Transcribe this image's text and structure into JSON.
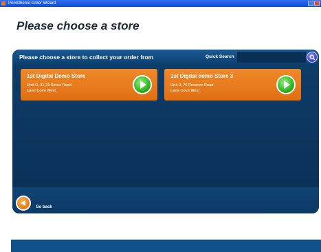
{
  "window": {
    "title": "Printstheme Order Wizard"
  },
  "page": {
    "title": "Please choose a store"
  },
  "panel": {
    "heading": "Please choose a store to collect your order from",
    "quick_search_label": "Quick Search",
    "search_value": "",
    "search_placeholder": ""
  },
  "stores": [
    {
      "name": "1st Digital Demo Store",
      "address_line1": "Unit C, 31-33 Sirius Road",
      "address_line2": "Lane Cove West"
    },
    {
      "name": "1st Digital demo Store 3",
      "address_line1": "Unit 3, 76 Reserve Road",
      "address_line2": "Lane Cove West"
    }
  ],
  "footer": {
    "back_label": "Go back"
  },
  "colors": {
    "panel": "#0b3a66",
    "card": "#e57a1a",
    "go_button": "#22a81a",
    "back_button": "#e07a10",
    "search_button": "#3a3cc8",
    "titlebar": "#1656e0"
  },
  "icons": {
    "app": "app-icon",
    "search": "search-icon",
    "go": "play-arrow-icon",
    "back": "back-arrow-icon"
  }
}
